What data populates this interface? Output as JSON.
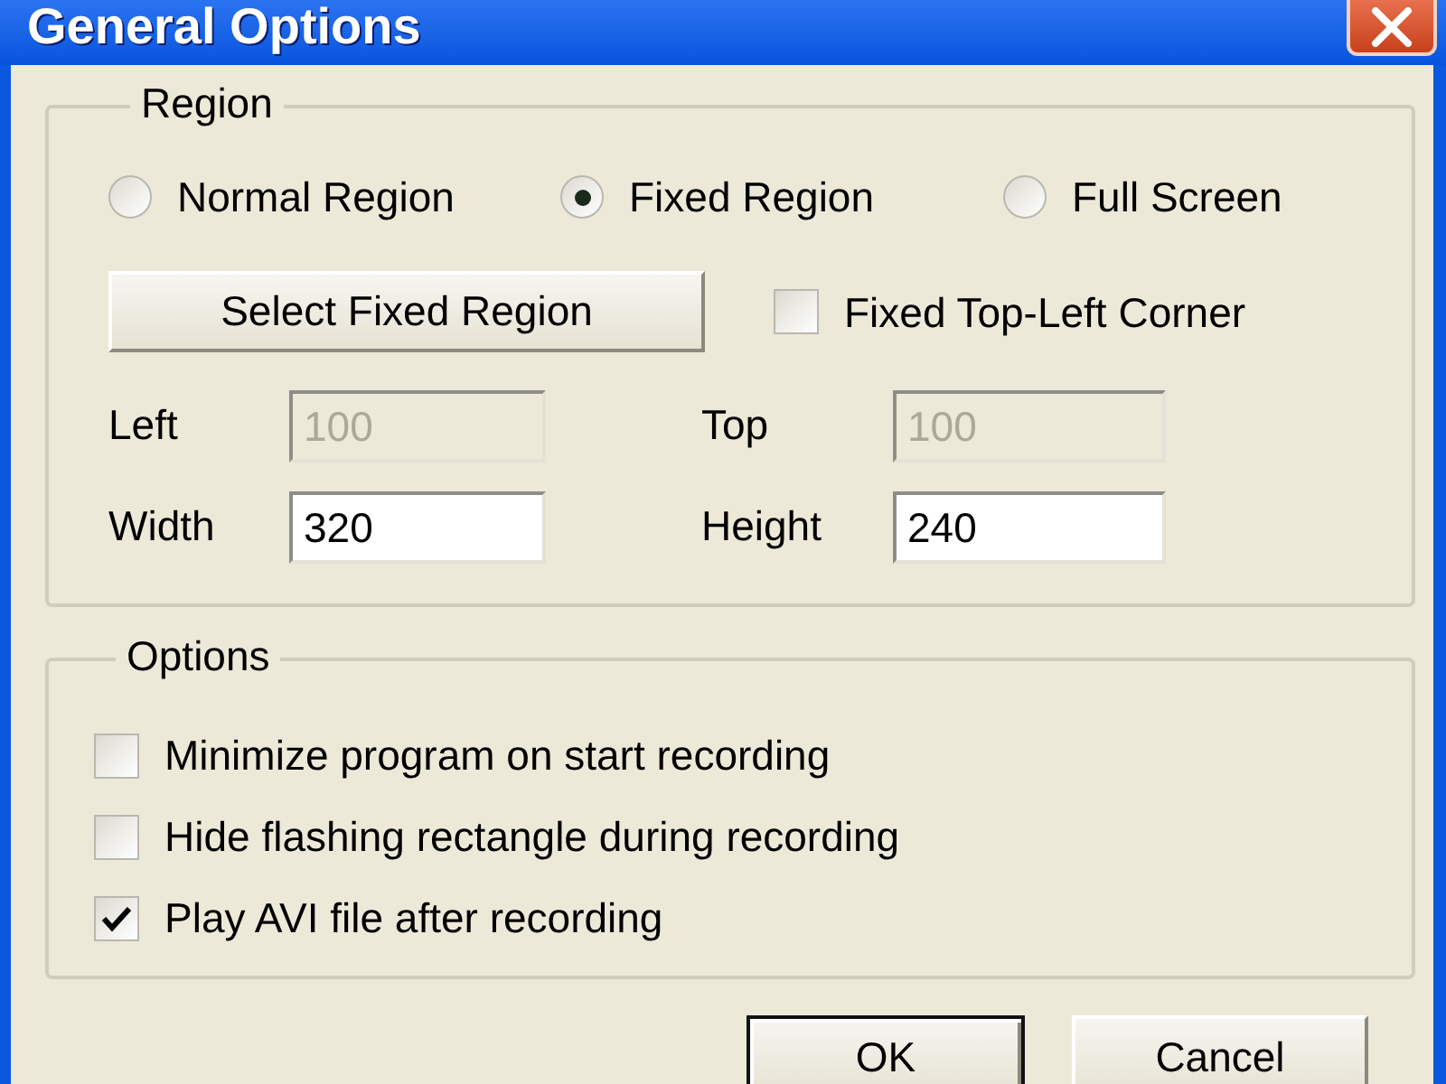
{
  "window": {
    "title": "General Options"
  },
  "region": {
    "label": "Region",
    "modes": [
      {
        "label": "Normal Region",
        "selected": false
      },
      {
        "label": "Fixed Region",
        "selected": true
      },
      {
        "label": "Full Screen",
        "selected": false
      }
    ],
    "select_button": "Select Fixed Region",
    "fixed_corner": {
      "label": "Fixed Top-Left Corner",
      "checked": false
    },
    "fields": [
      {
        "label": "Left",
        "value": "100",
        "disabled": true
      },
      {
        "label": "Top",
        "value": "100",
        "disabled": true
      },
      {
        "label": "Width",
        "value": "320",
        "disabled": false
      },
      {
        "label": "Height",
        "value": "240",
        "disabled": false
      }
    ]
  },
  "options": {
    "label": "Options",
    "items": [
      {
        "label": "Minimize program on start recording",
        "checked": false
      },
      {
        "label": "Hide flashing rectangle during recording",
        "checked": false
      },
      {
        "label": "Play AVI file after recording",
        "checked": true
      }
    ]
  },
  "buttons": [
    {
      "label": "OK",
      "default": true
    },
    {
      "label": "Cancel",
      "default": false
    }
  ]
}
